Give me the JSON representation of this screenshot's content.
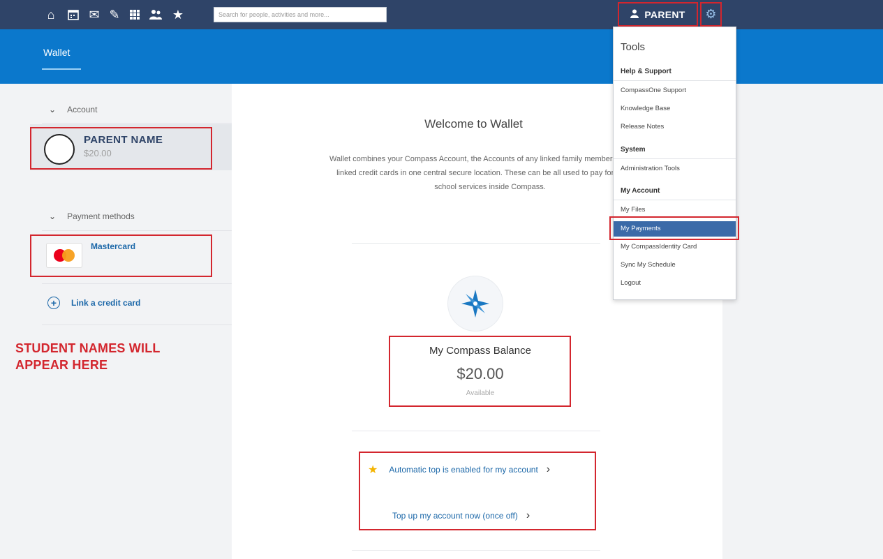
{
  "nav": {
    "icons": [
      "home-icon",
      "calendar-icon",
      "mail-icon",
      "pencil-icon",
      "grid-icon",
      "people-icon",
      "star-icon"
    ],
    "search_placeholder": "Search for people, activities and more...",
    "user_label": "PARENT"
  },
  "banner": {
    "tab": "Wallet"
  },
  "sidebar": {
    "account_heading": "Account",
    "parent_name": "PARENT NAME",
    "parent_balance": "$20.00",
    "payment_heading": "Payment methods",
    "card_name": "Mastercard",
    "link_card": "Link a credit card",
    "students_note_line1": "STUDENT NAMES WILL",
    "students_note_line2": "APPEAR HERE"
  },
  "main": {
    "welcome": "Welcome to Wallet",
    "description": "Wallet combines your Compass Account, the Accounts of any linked family members, and your linked credit cards in one central secure location. These can be all used to pay for different school services inside Compass.",
    "balance_title": "My Compass Balance",
    "balance_value": "$20.00",
    "balance_sub": "Available",
    "auto_topup": "Automatic top is enabled for my account",
    "topup_now": "Top up my account now (once off)"
  },
  "dropdown": {
    "title": "Tools",
    "help_heading": "Help & Support",
    "help_items": [
      "CompassOne Support",
      "Knowledge Base",
      "Release Notes"
    ],
    "system_heading": "System",
    "system_items": [
      "Administration Tools"
    ],
    "account_heading": "My Account",
    "account_items": [
      "My Files",
      "My Payments",
      "My CompassIdentity Card",
      "Sync My Schedule",
      "Logout"
    ]
  },
  "colors": {
    "nav_bg": "#2f4468",
    "banner_bg": "#0b78cc",
    "highlight_red": "#d3262e",
    "link_blue": "#1b67a8",
    "menu_highlight": "#3b6aa8"
  }
}
